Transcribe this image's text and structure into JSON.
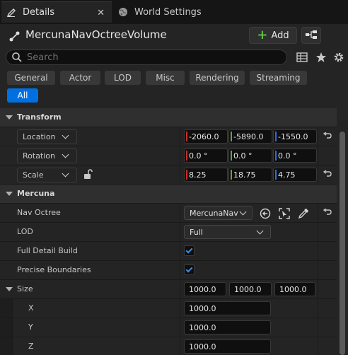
{
  "tabs": {
    "details": {
      "label": "Details",
      "close": "✕"
    },
    "world_settings": {
      "label": "World Settings"
    }
  },
  "header": {
    "actor_name": "MercunaNavOctreeVolume",
    "add_label": "Add"
  },
  "search": {
    "placeholder": "Search"
  },
  "categories": [
    "General",
    "Actor",
    "LOD",
    "Misc",
    "Rendering",
    "Streaming",
    "All"
  ],
  "selected_category": "All",
  "transform": {
    "section_label": "Transform",
    "location": {
      "label": "Location",
      "x": "-2060.0",
      "y": "-5890.0",
      "z": "-1550.0"
    },
    "rotation": {
      "label": "Rotation",
      "x": "0.0 °",
      "y": "0.0 °",
      "z": "0.0 °"
    },
    "scale": {
      "label": "Scale",
      "x": "8.25",
      "y": "18.75",
      "z": "4.75"
    }
  },
  "mercuna": {
    "section_label": "Mercuna",
    "nav_octree": {
      "label": "Nav Octree",
      "value": "MercunaNav"
    },
    "lod": {
      "label": "LOD",
      "value": "Full"
    },
    "full_detail_build": {
      "label": "Full Detail Build",
      "checked": true
    },
    "precise_boundaries": {
      "label": "Precise Boundaries",
      "checked": true
    },
    "size": {
      "label": "Size",
      "x": "1000.0",
      "y": "1000.0",
      "z": "1000.0"
    },
    "size_x": {
      "label": "X",
      "value": "1000.0"
    },
    "size_y": {
      "label": "Y",
      "value": "1000.0"
    },
    "size_z": {
      "label": "Z",
      "value": "1000.0"
    }
  },
  "colors": {
    "accent": "#0070e0",
    "axis_x": "#c8302a",
    "axis_y": "#5fa83a",
    "axis_z": "#2f6fd6",
    "checkbox": "#3b8eea",
    "add_plus": "#5fbf3f"
  }
}
